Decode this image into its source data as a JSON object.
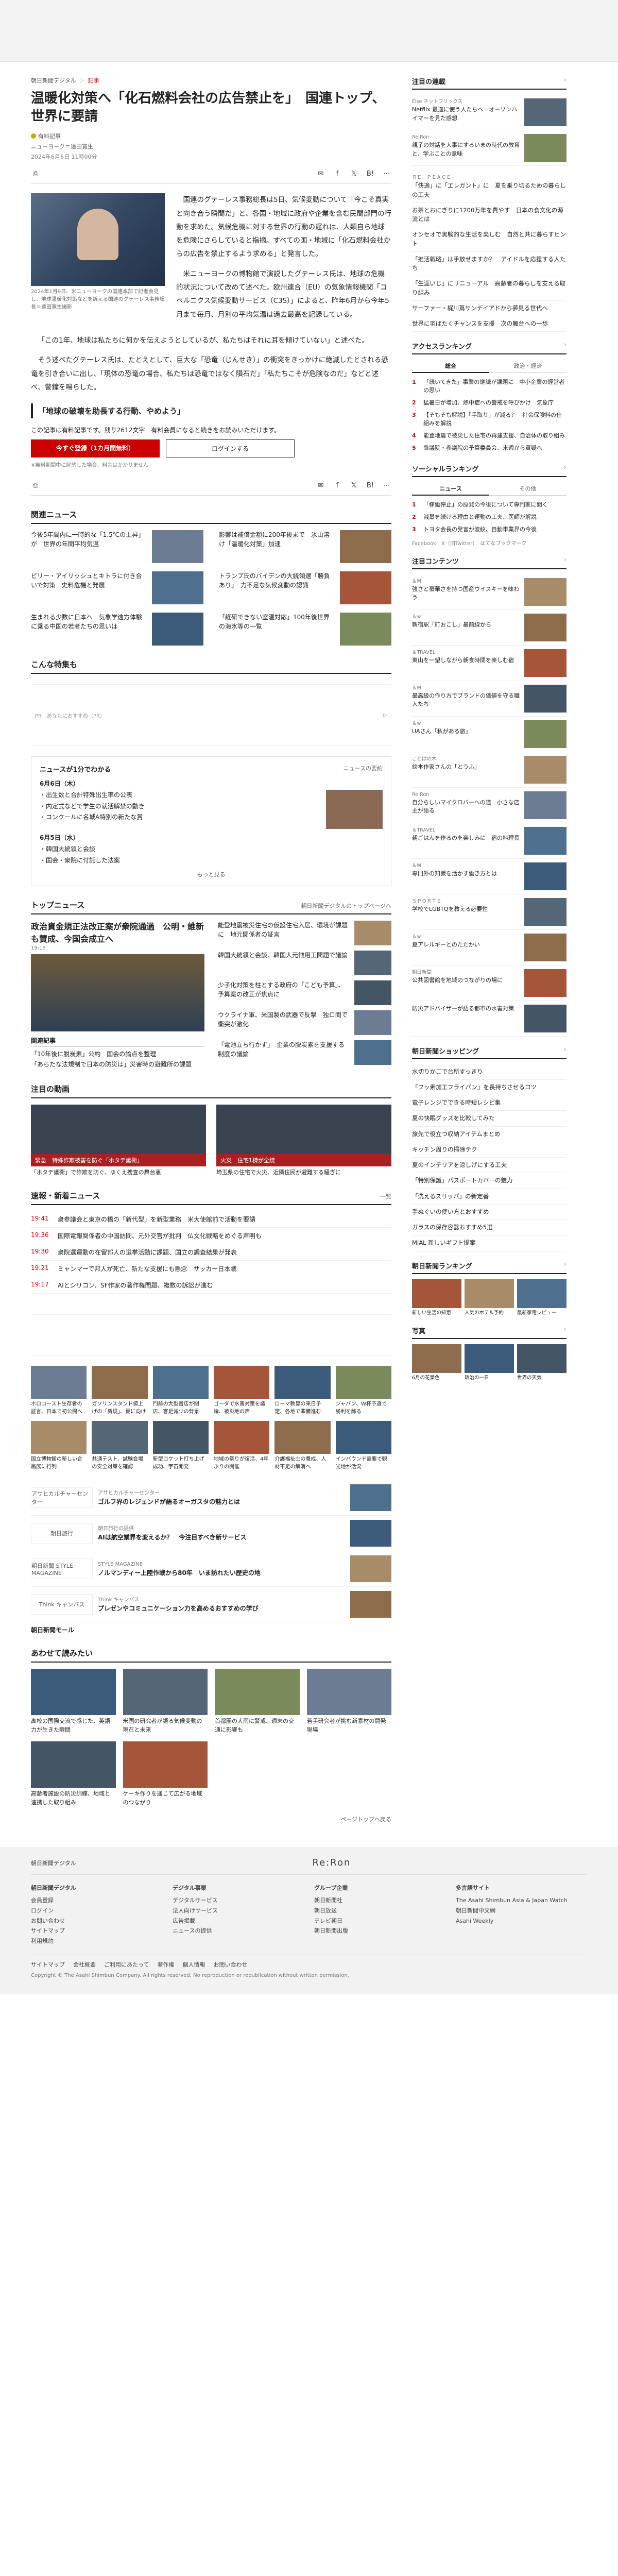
{
  "header": {
    "ad_label": ""
  },
  "breadcrumb": [
    "朝日新聞デジタル",
    "記事"
  ],
  "article": {
    "title": "温暖化対策へ「化石燃料会社の広告禁止を」　国連トップ、世界に要請",
    "author": "有料記事",
    "dept": "ニューヨーク＝遠田寛生",
    "date": "2024年6月6日 11時00分",
    "photo_caption": "2024年1月9日、米ニューヨークの国連本部で記者会見し、地球温暖化対策などを訴える国連のグテーレス事務総長＝遠田寛生撮影",
    "p1": "国連のグテーレス事務総長は5日、気候変動について「今こそ真実と向き合う瞬間だ」と、各国・地域に政府や企業を含む民間部門の行動を求めた。気候危機に対する世界の行動の遅れは、人類自ら地球を危険にさらしていると指摘。すべての国・地域に「化石燃料会社からの広告を禁止するよう求める」と発言した。",
    "p2": "米ニューヨークの博物館で演説したグテーレス氏は、地球の危機的状況について改めて述べた。欧州連合（EU）の気象情報機関「コペルニクス気候変動サービス（C3S）」によると、昨年6月から今年5月まで毎月、月別の平均気温は過去最高を記録している。",
    "p3": "「この1年、地球は私たちに何かを伝えようとしているが、私たちはそれに耳を傾けていない」と述べた。",
    "p4": "そう述べたグテーレス氏は、たとえとして、巨大な「恐竜（じんせき）」の衝突をきっかけに絶滅したとされる恐竜を引き合いに出し、「現体の恐竜の場合、私たちは恐竜ではなく隕石だ」「私たちこそが危険なのだ」などと述べ、警鐘を鳴らした。",
    "quote": "「地球の破壊を助長する行動、やめよう」",
    "paywall_text": "この記事は有料記事です。残り2612文字　有料会員になると続きをお読みいただけます。",
    "paywall_highlight": "有料記事",
    "btn_subscribe": "今すぐ登録（1カ月間無料）",
    "btn_login": "ログインする",
    "paywall_note": "※無料期間中に解約した場合、料金はかかりません"
  },
  "toolbar": {
    "print_label": "印刷",
    "share_icons": [
      "mail-icon",
      "facebook-icon",
      "x-icon",
      "bookmark-icon",
      "more-icon"
    ]
  },
  "related": {
    "heading": "関連ニュース",
    "items": [
      "今後5年間内に一時的な「1.5℃の上昇」が　世界の年間平均気温",
      "影響は補償金額に200年後まで　氷山溶け「温暖化対策」加速",
      "ビリー・アイリッシュとキトラに付き合いで対策　史料危機と発展",
      "トランプ氏のバイデンの大統領選「勝負あり」　力不足な気候変動の認識",
      "生まれる少数に日本へ　気象学遠方体験に乗る中国の若者たちの思いは",
      "「経研できない室温対応」100年後世界の海氷等の一覧"
    ]
  },
  "special": {
    "heading": "こんな特集も"
  },
  "ad_text": "PR　あなたにおすすめ（PR）",
  "schedule": {
    "heading": "ニュースが1分でわかる",
    "sub": "ニュースの要約",
    "day1": "6月6日（木）",
    "day1_items": [
      "出生数と合計特殊出生率の公表",
      "内定式などで学生の就活解禁の動き",
      "コンクールに名城A特別の新たな賞"
    ],
    "day2": "6月5日（水）",
    "day2_items": [
      "韓国大統領と会談",
      "国会・衆院に付託した法案"
    ],
    "more": "もっと見る"
  },
  "top_news": {
    "heading": "トップニュース",
    "sub": "朝日新聞デジタルのトップページへ",
    "lead": "政治資金規正法改正案が衆院通過　公明・維新も賛成、今国会成立へ",
    "lead_time": "19:15",
    "list": [
      "能登地震被災住宅の仮設住宅入居、環境が課題に　地元関係者の証言",
      "韓国大統領と会談、韓国人元徴用工問題で議論",
      "少子化対策を柱とする政府の「こども予算」、予算案の改正が焦点に",
      "ウクライナ軍、米国製の武器で反撃　独ロ間で衝突が激化",
      "「電池立ち行かず」　企業の脱炭素を支援する制度の議論"
    ],
    "related_heading": "関連記事",
    "related": [
      "「10年後に脱炭素」公約　国会の論点を整理",
      "「あらたな法規制で日本の防災は」災害時の避難所の課題"
    ]
  },
  "videos": {
    "heading": "注目の動画",
    "items": [
      {
        "band": "緊急　特殊詐欺被害を防ぐ「ホタテ護衛」",
        "cap": "「ホタテ護衛」で詐欺を防ぐ、ゆくえ捜査の舞台裏"
      },
      {
        "band": "火災　住宅1棟が全焼",
        "cap": "埼玉県の住宅で火災、近隣住民が避難する騒ぎに"
      }
    ]
  },
  "breaking": {
    "heading": "速報・新着ニュース",
    "sub": "一覧",
    "items": [
      {
        "time": "19:41",
        "text": "衆参議会と東京の橋の「新代型」を新型業務　米大使館前で活動を要請"
      },
      {
        "time": "19:36",
        "text": "国際電報関係者の中国訪問、元外交官が批判　仏文化戦略をめぐる声明も"
      },
      {
        "time": "19:30",
        "text": "衆院選運動の在留邦人の選挙活動に課題、国立の調査結果が発表"
      },
      {
        "time": "19:21",
        "text": "ミャンマーで邦人が死亡、新たな支援にも懸念　サッカー日本戦"
      },
      {
        "time": "19:17",
        "text": "AIとシリコン、SF作家の著作権問題、複数の訴訟が進む"
      }
    ]
  },
  "grid_a": [
    "ホロコースト生存者の証言、日本で初公開へ",
    "ガソリンスタンド値上げの「新規」、夏に向け",
    "門前の大型書店が閉店、客足減少の背景",
    "ゴーダで水害対策を議論、被災地の声",
    "ローマ教皇の来日予定、各地で準備進む",
    "ジャパン、Ｗ杯予選で勝利を飾る",
    "国立博物館の新しい企画展に行列",
    "共通テスト、試験会場の安全対策を確認",
    "新型ロケット打ち上げ成功、宇宙開発",
    "地域の祭りが復活、4年ぶりの開催",
    "介護福祉士の養成、人材不足の解消へ",
    "インバウンド需要で観光地が活況"
  ],
  "pr": {
    "items": [
      {
        "logo": "アサヒカルチャーセンター",
        "title": "ゴルフ界のレジェンドが語るオーガスタの魅力とは",
        "sub": "アサヒカルチャーセンター"
      },
      {
        "logo": "朝日旅行",
        "title": "AIは航空業界を変えるか？　今注目すべき新サービス",
        "sub": "朝日旅行の提供"
      },
      {
        "logo": "朝日新聞 STYLE MAGAZINE",
        "title": "ノルマンディー上陸作戦から80年　いま訪れたい歴史の地",
        "sub": "STYLE MAGAZINE"
      },
      {
        "logo": "Think キャンパス",
        "title": "プレゼンやコミュニケーション力を高めるおすすめの学び",
        "sub": "Think キャンパス"
      }
    ],
    "footer_title": "朝日新聞モール"
  },
  "recommend": {
    "heading": "あわせて読みたい",
    "items": [
      "高校の国際交流で感じた、英語力が生きた瞬間",
      "米国の研究者が語る気候変動の現在と未来",
      "首都圏の大雨に警戒、週末の交通に影響も",
      "若手研究者が挑む新素材の開発現場",
      "高齢者施設の防災訓練、地域と連携した取り組み",
      "ケーキ作りを通じて広がる地域のつながり"
    ],
    "pagetop": "ページトップへ戻る"
  },
  "sidebar": {
    "notable_heading": "注目の連載",
    "notable": [
      {
        "kicker": "Else ネットフリックス",
        "text": "Netflix 最適に使う人たちへ　オーソンハイマーを見た感想"
      },
      {
        "kicker": "Re:Ron",
        "text": "親子の対話を大事にするいまの時代の教育と、学ぶことの意味"
      }
    ],
    "list_heading": "",
    "text_items": [
      {
        "kicker": "ＲＥ：ＰＥＡＣＥ",
        "text": "「快適」に「エレガント」に　夏を乗り切るための暮らしの工夫"
      },
      {
        "kicker": "",
        "text": "お茶とおにぎりに1200万年を費やす　日本の食文化の源流とは"
      },
      {
        "kicker": "",
        "text": "オンセオで実験的な生活を楽しむ　自然と共に暮らすヒント"
      },
      {
        "kicker": "",
        "text": "「推活戦略」は手放せますか？　アイドルを応援する人たち"
      },
      {
        "kicker": "",
        "text": "「生涯いじ」にリニューアル　高齢者の暮らしを支える取り組み"
      },
      {
        "kicker": "",
        "text": "サーファー・梶川蔦サンデイアドから夢見る世代へ"
      },
      {
        "kicker": "",
        "text": "世界に羽ばたくチャンスを支援　次の舞台への一歩"
      }
    ],
    "ranking_heading": "アクセスランキング",
    "ranking_tabs": [
      "総合",
      "政治・経済"
    ],
    "ranking": [
      "「続いてきた」事業の継続が課題に　中小企業の経営者の思い",
      "猛暑日が増加、熱中症への警戒を呼びかけ　気象庁",
      "【そもそも解説】「手取り」が減る？　社会保険料の仕組みを解説",
      "能登地震で被災した住宅の再建支援、自治体の取り組み",
      "衆議院・参議院の予算委員会、来週から質疑へ"
    ],
    "social_heading": "ソーシャルランキング",
    "social_tabs": [
      "ニュース",
      "その他"
    ],
    "social": [
      "「稼働停止」の原発の今後について専門家に聞く",
      "減量を続ける理由と運動の工夫、医師が解説",
      "トヨタ会長の発言が波紋、自動車業界の今後"
    ],
    "social_footer": "Facebook　X（旧Twitter）　はてなブックマーク",
    "contents_heading": "注目コンテンツ",
    "contents": [
      {
        "kicker": "＆M",
        "text": "強さと豪華さを持つ国産ウイスキーを味わう"
      },
      {
        "kicker": "＆w",
        "text": "新宿駅「町おこし」最前線から"
      },
      {
        "kicker": "＆TRAVEL",
        "text": "東山を一望しながら朝食時間を楽しむ宿"
      },
      {
        "kicker": "＆M",
        "text": "最高級の作り方でブランドの価値を守る職人たち"
      },
      {
        "kicker": "＆w",
        "text": "UAさん「私がある旅」"
      },
      {
        "kicker": "ことばの木",
        "text": "絵本作家さんの「とうふ」"
      },
      {
        "kicker": "Re:Ron",
        "text": "自分らしいマイクロバーへの道　小さな店主が語る"
      },
      {
        "kicker": "＆TRAVEL",
        "text": "朝ごはんを作るのを楽しみに　宿の料理長"
      },
      {
        "kicker": "＆M",
        "text": "専門外の知識を活かす働き方とは"
      },
      {
        "kicker": "ＳＰＯＲＴＳ",
        "text": "学校でLGBTQを教える必要性"
      },
      {
        "kicker": "＆w",
        "text": "夏アレルギーとのたたかい"
      },
      {
        "kicker": "朝日新聞",
        "text": "公共図書館を地域のつながりの場に"
      },
      {
        "kicker": "",
        "text": "防災アドバイザーが語る都市の水害対策"
      }
    ],
    "shopping_heading": "朝日新聞ショッピング",
    "shopping": [
      "水切りかごで台所すっきり",
      "「フッ素加工フライパン」を長持ちさせるコツ",
      "電子レンジでできる時短レシピ集",
      "夏の快眠グッズを比較してみた",
      "旅先で役立つ収納アイテムまとめ",
      "キッチン周りの掃除テク",
      "夏のインテリアを涼しげにする工夫",
      "「特別保護」パスポートカバーの魅力",
      "「洗えるスリッパ」の新定番",
      "手ぬぐいの使い方とおすすめ",
      "ガラスの保存容器おすすめ5選",
      "MIAL 新しいギフト提案"
    ],
    "ranking2_heading": "朝日新聞ランキング",
    "ranking2": [
      "新しい生活の知恵",
      "人気のホテル予約",
      "最新家電レビュー"
    ],
    "photo_heading": "写真",
    "photos": [
      "6月の花景色",
      "政治の一日",
      "世界の天気"
    ]
  },
  "footer": {
    "brand_left": "朝日新聞デジタル",
    "brand_center": "Re:Ron",
    "cols": [
      {
        "h": "朝日新聞デジタル",
        "items": [
          "会員登録",
          "ログイン",
          "お問い合わせ",
          "サイトマップ",
          "利用規約"
        ]
      },
      {
        "h": "デジタル事業",
        "items": [
          "デジタルサービス",
          "法人向けサービス",
          "広告掲載",
          "ニュースの提供"
        ]
      },
      {
        "h": "グループ企業",
        "items": [
          "朝日新聞社",
          "朝日放送",
          "テレビ朝日",
          "朝日新聞出版"
        ]
      },
      {
        "h": "多言語サイト",
        "items": [
          "The Asahi Shimbun Asia & Japan Watch",
          "朝日新聞中文網",
          "Asahi Weekly"
        ]
      }
    ],
    "bottom": [
      "サイトマップ",
      "会社概要",
      "ご利用にあたって",
      "著作権",
      "個人情報",
      "お問い合わせ"
    ],
    "copyright": "Copyright © The Asahi Shimbun Company. All rights reserved. No reproduction or republication without written permission."
  }
}
